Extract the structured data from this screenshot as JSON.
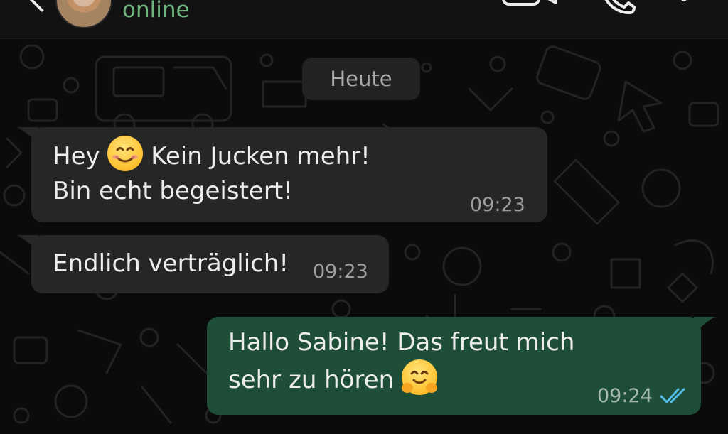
{
  "header": {
    "contact_status": "online"
  },
  "chat": {
    "date_divider": "Heute",
    "messages": [
      {
        "direction": "incoming",
        "line1_before_emoji": "Hey",
        "emoji": "smiling-face-with-smiling-eyes",
        "line1_after_emoji": "Kein Jucken mehr!",
        "line2": "Bin echt begeistert!",
        "time": "09:23"
      },
      {
        "direction": "incoming",
        "text": "Endlich verträglich!",
        "time": "09:23"
      },
      {
        "direction": "outgoing",
        "line1": "Hallo Sabine! Das freut mich",
        "line2": "sehr zu hören",
        "emoji": "smiling-face-with-hands",
        "time": "09:24",
        "status": "read"
      }
    ]
  },
  "colors": {
    "incoming_bubble": "#262626",
    "outgoing_bubble": "#1f4e38",
    "status_online": "#6fb57d",
    "read_ticks": "#53bdeb"
  }
}
